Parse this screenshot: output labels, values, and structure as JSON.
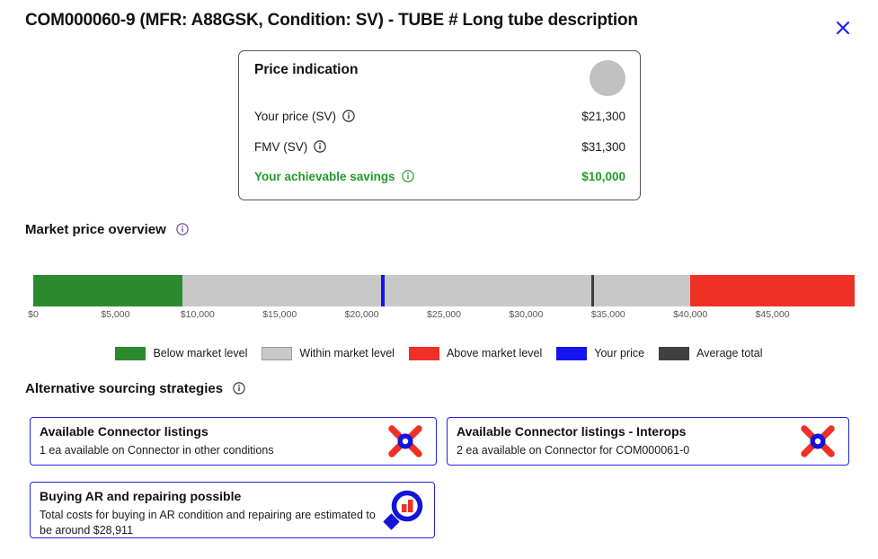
{
  "header": {
    "title": "COM000060-9 (MFR: A88GSK, Condition: SV) - TUBE # Long tube description",
    "close_label": "×"
  },
  "price_card": {
    "title": "Price indication",
    "rows": [
      {
        "label": "Your price (SV)",
        "value": "$21,300",
        "info": true
      },
      {
        "label": "FMV (SV)",
        "value": "$31,300",
        "info": true
      },
      {
        "label": "Your achievable savings",
        "value": "$10,000",
        "info": true
      }
    ],
    "savings_color": "#1f9c28",
    "badge_color": "#c0c0c0"
  },
  "market": {
    "heading": "Market price overview",
    "info_icon_color": "#7b3fa0"
  },
  "alternatives": {
    "heading": "Alternative sourcing strategies",
    "cards": [
      {
        "title": "Available Connector listings",
        "description": "1 ea available on Connector in other conditions",
        "icon": "connector-x-icon"
      },
      {
        "title": "Available Connector listings - Interops",
        "description": "2 ea available on Connector for COM000061-0",
        "icon": "connector-x-icon"
      },
      {
        "title": "Buying AR and repairing possible",
        "description": "Total costs for buying in AR condition and repairing are estimated to be around $28,911",
        "icon": "magnifier-bars-icon"
      }
    ]
  },
  "chart_data": {
    "type": "bar",
    "title": "Market price overview",
    "xlabel": "",
    "ylabel": "",
    "xlim": [
      0,
      50000
    ],
    "grid": false,
    "legend_position": "bottom",
    "tick_labels": [
      "$0",
      "$5,000",
      "$10,000",
      "$15,000",
      "$20,000",
      "$25,000",
      "$30,000",
      "$35,000",
      "$40,000",
      "$45,000"
    ],
    "tick_values": [
      0,
      5000,
      10000,
      15000,
      20000,
      25000,
      30000,
      35000,
      40000,
      45000
    ],
    "segments": [
      {
        "name": "Below market level",
        "from": 0,
        "to": 9100,
        "color": "#2a8a2d"
      },
      {
        "name": "Within market level",
        "from": 9100,
        "to": 40000,
        "color": "#c8c8c8"
      },
      {
        "name": "Above market level",
        "from": 40000,
        "to": 50000,
        "color": "#ee3124"
      }
    ],
    "markers": [
      {
        "name": "Your price",
        "value": 21300,
        "color": "#1414f0"
      },
      {
        "name": "Average total",
        "value": 34100,
        "color": "#3f3f3f"
      }
    ],
    "legend": [
      {
        "label": "Below market level",
        "color": "#2a8a2d",
        "swatch": "solid"
      },
      {
        "label": "Within market level",
        "color": "#c8c8c8",
        "swatch": "outlined"
      },
      {
        "label": "Above market level",
        "color": "#ee3124",
        "swatch": "solid"
      },
      {
        "label": "Your price",
        "color": "#1414f0",
        "swatch": "solid"
      },
      {
        "label": "Average total",
        "color": "#3f3f3f",
        "swatch": "solid"
      }
    ]
  }
}
